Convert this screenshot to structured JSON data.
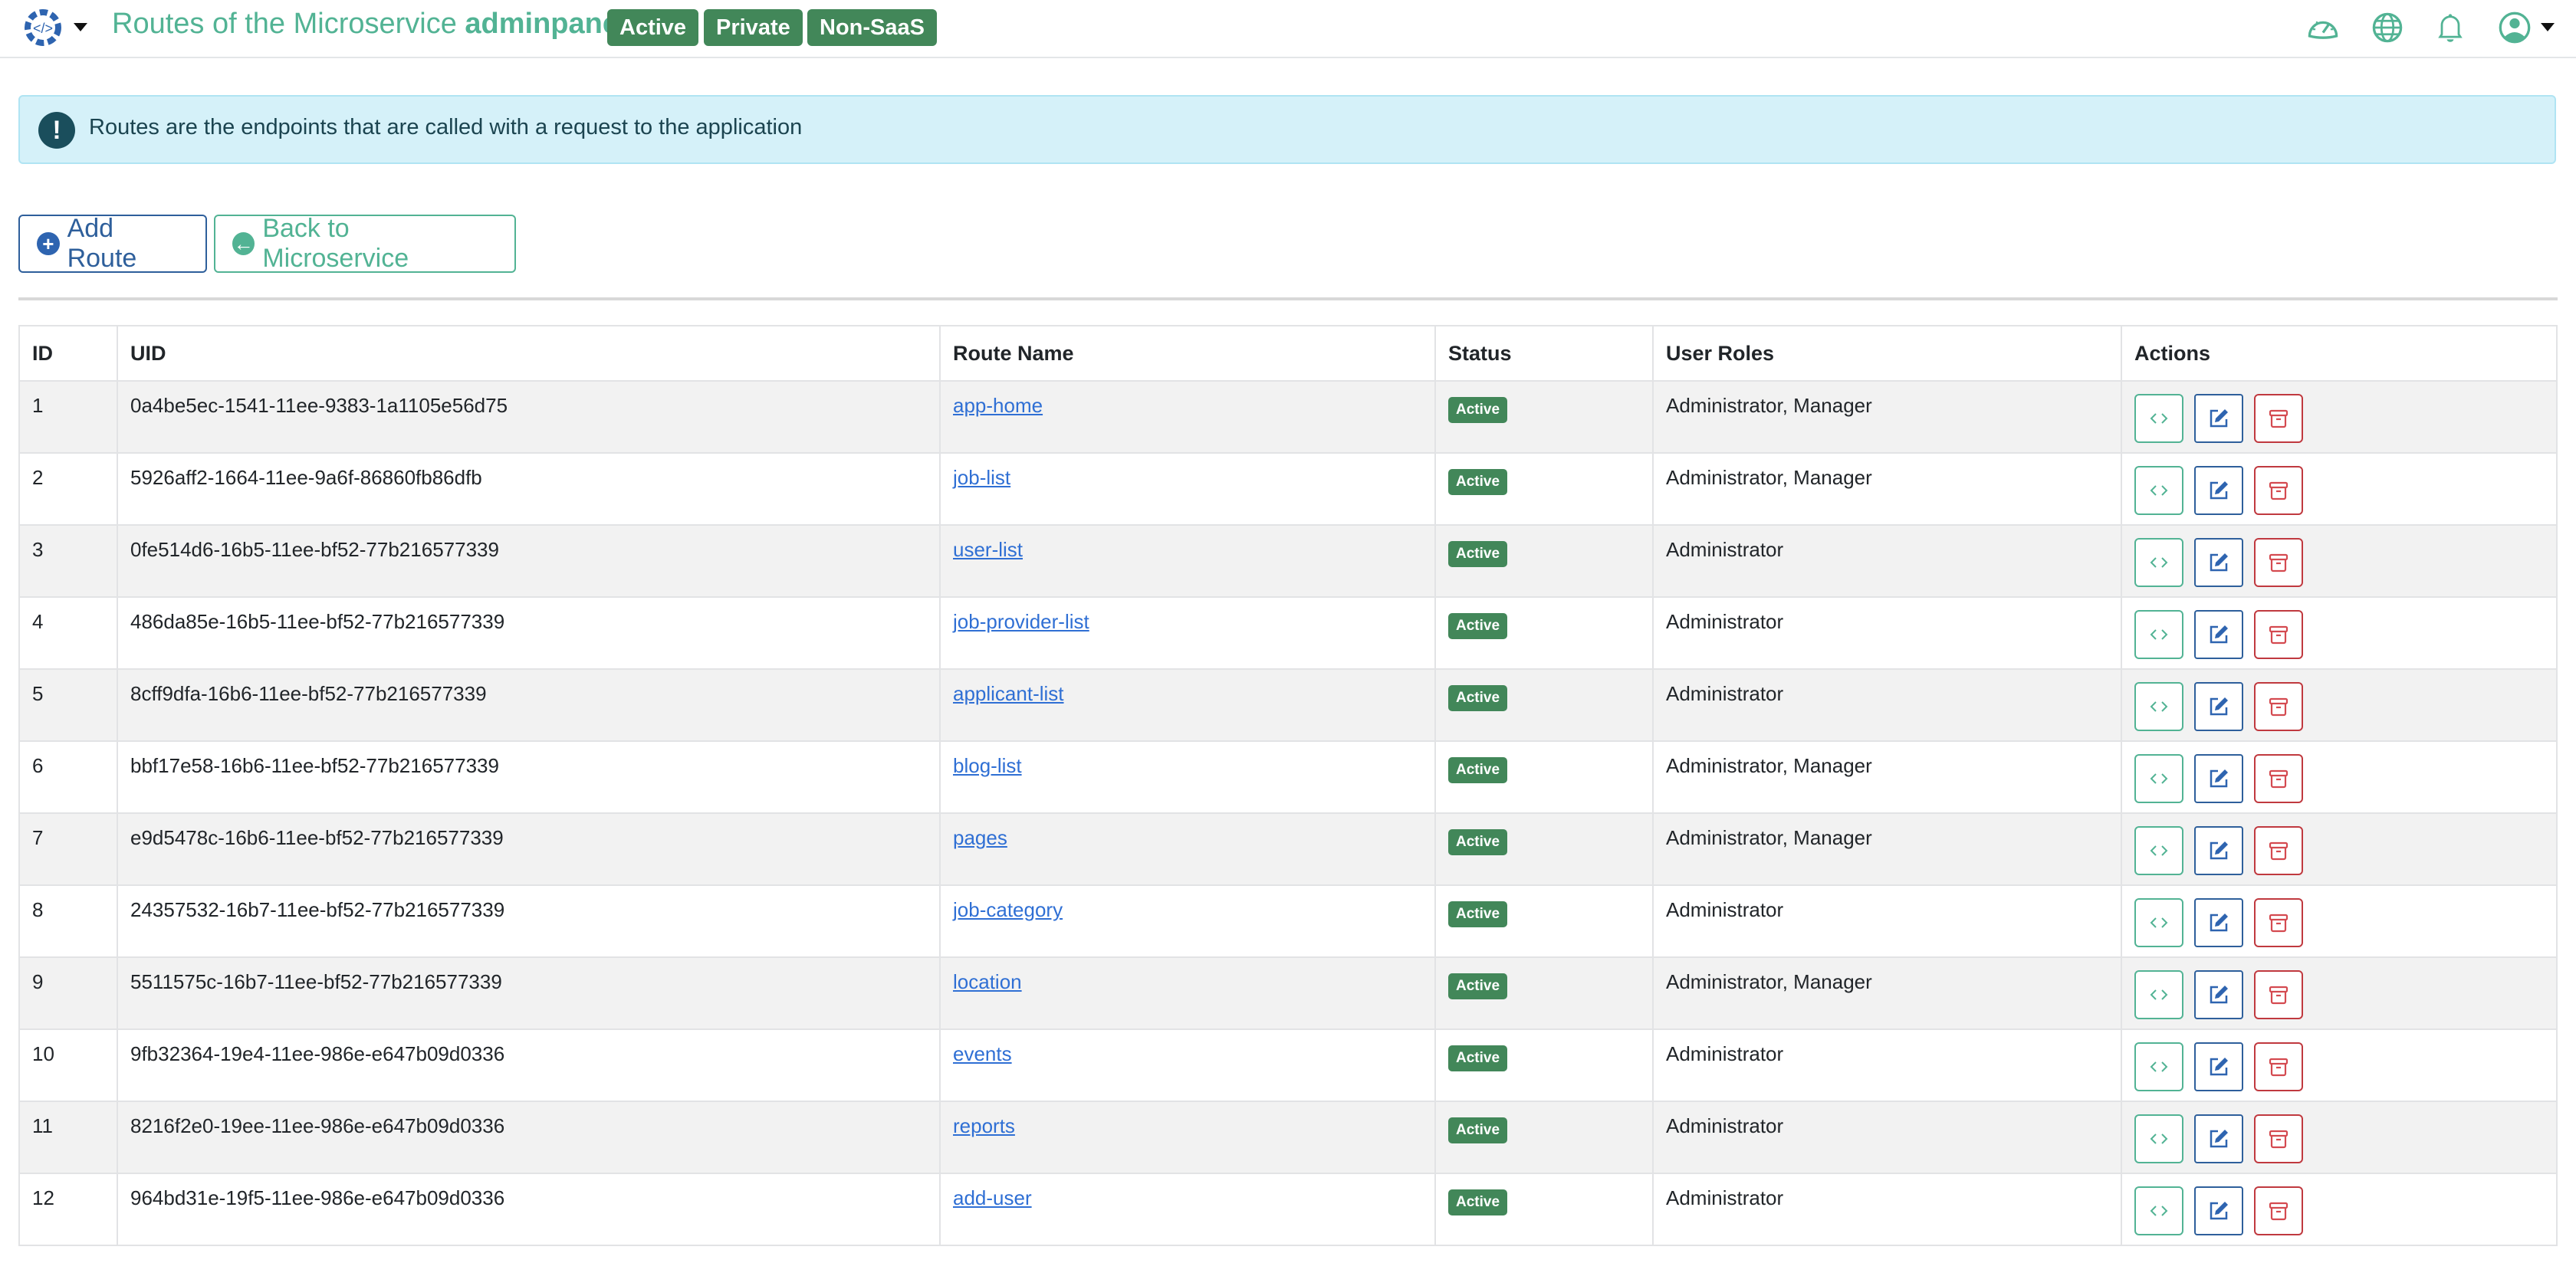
{
  "header": {
    "title_prefix": "Routes of the Microservice",
    "title_name": "adminpanel",
    "badges": [
      "Active",
      "Private",
      "Non-SaaS"
    ],
    "icons": [
      "code-gear-logo-icon",
      "dashboard-speedometer-icon",
      "globe-icon",
      "bell-icon",
      "user-avatar-icon"
    ]
  },
  "alert": {
    "icon": "exclamation-icon",
    "message": "Routes are the endpoints that are called with a request to the application"
  },
  "toolbar": {
    "add_label": "Add Route",
    "back_label": "Back to Microservice"
  },
  "table": {
    "columns": [
      "ID",
      "UID",
      "Route Name",
      "Status",
      "User Roles",
      "Actions"
    ],
    "rows": [
      {
        "id": "1",
        "uid": "0a4be5ec-1541-11ee-9383-1a1105e56d75",
        "route": "app-home",
        "status": "Active",
        "roles": "Administrator, Manager"
      },
      {
        "id": "2",
        "uid": "5926aff2-1664-11ee-9a6f-86860fb86dfb",
        "route": "job-list",
        "status": "Active",
        "roles": "Administrator, Manager"
      },
      {
        "id": "3",
        "uid": "0fe514d6-16b5-11ee-bf52-77b216577339",
        "route": "user-list",
        "status": "Active",
        "roles": "Administrator"
      },
      {
        "id": "4",
        "uid": "486da85e-16b5-11ee-bf52-77b216577339",
        "route": "job-provider-list",
        "status": "Active",
        "roles": "Administrator"
      },
      {
        "id": "5",
        "uid": "8cff9dfa-16b6-11ee-bf52-77b216577339",
        "route": "applicant-list",
        "status": "Active",
        "roles": "Administrator"
      },
      {
        "id": "6",
        "uid": "bbf17e58-16b6-11ee-bf52-77b216577339",
        "route": "blog-list",
        "status": "Active",
        "roles": "Administrator, Manager"
      },
      {
        "id": "7",
        "uid": "e9d5478c-16b6-11ee-bf52-77b216577339",
        "route": "pages",
        "status": "Active",
        "roles": "Administrator, Manager"
      },
      {
        "id": "8",
        "uid": "24357532-16b7-11ee-bf52-77b216577339",
        "route": "job-category",
        "status": "Active",
        "roles": "Administrator"
      },
      {
        "id": "9",
        "uid": "5511575c-16b7-11ee-bf52-77b216577339",
        "route": "location",
        "status": "Active",
        "roles": "Administrator, Manager"
      },
      {
        "id": "10",
        "uid": "9fb32364-19e4-11ee-986e-e647b09d0336",
        "route": "events",
        "status": "Active",
        "roles": "Administrator"
      },
      {
        "id": "11",
        "uid": "8216f2e0-19ee-11ee-986e-e647b09d0336",
        "route": "reports",
        "status": "Active",
        "roles": "Administrator"
      },
      {
        "id": "12",
        "uid": "964bd31e-19f5-11ee-986e-e647b09d0336",
        "route": "add-user",
        "status": "Active",
        "roles": "Administrator"
      }
    ],
    "action_icons": [
      "code-icon",
      "edit-icon",
      "archive-icon"
    ]
  },
  "colors": {
    "brand": "#52b394",
    "badge_green": "#428759",
    "primary_blue": "#2e5f9b",
    "danger_red": "#c0393f",
    "alert_bg": "#d5f1f9",
    "link": "#2f6fd4"
  }
}
